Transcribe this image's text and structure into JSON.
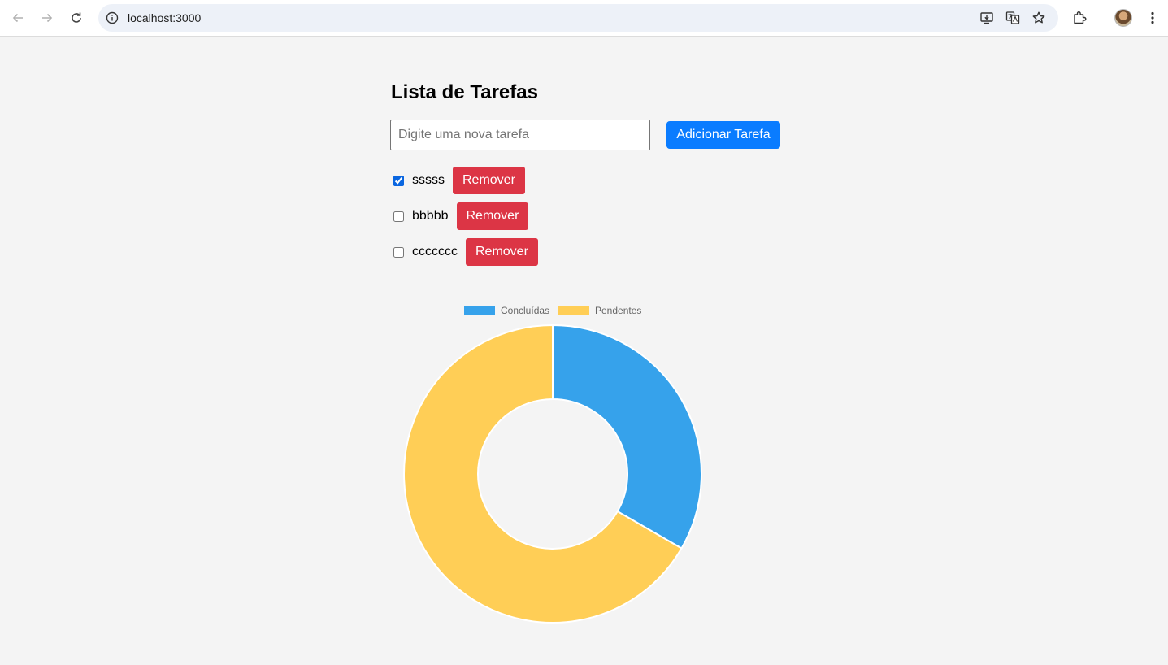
{
  "browser": {
    "url": "localhost:3000",
    "icons": [
      "back-arrow-icon",
      "forward-arrow-icon",
      "reload-icon",
      "site-info-icon",
      "install-app-icon",
      "translate-icon",
      "bookmark-star-icon",
      "extensions-icon",
      "profile-avatar",
      "more-menu-icon"
    ]
  },
  "app": {
    "title": "Lista de Tarefas",
    "input_value": "",
    "input_placeholder": "Digite uma nova tarefa",
    "add_label": "Adicionar Tarefa",
    "tasks": [
      {
        "text": "sssss",
        "done": true,
        "remove_label": "Remover"
      },
      {
        "text": "bbbbb",
        "done": false,
        "remove_label": "Remover"
      },
      {
        "text": "ccccccc",
        "done": false,
        "remove_label": "Remover"
      }
    ]
  },
  "chart_data": {
    "type": "pie",
    "variant": "doughnut",
    "labels": [
      "Concluídas",
      "Pendentes"
    ],
    "values": [
      1,
      2
    ],
    "colors": [
      "#36a2eb",
      "#ffce56"
    ],
    "legend": "top"
  }
}
